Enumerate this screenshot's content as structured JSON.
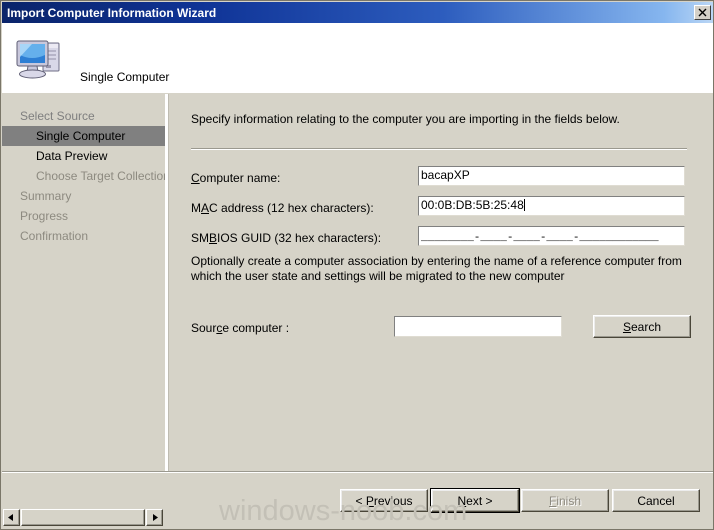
{
  "window": {
    "title": "Import Computer Information Wizard",
    "close_label": "x"
  },
  "header": {
    "title": "Single Computer",
    "icon": "computer-icon"
  },
  "sidebar": {
    "items": [
      {
        "label": "Select Source",
        "level": 0,
        "state": "done"
      },
      {
        "label": "Single Computer",
        "level": 1,
        "state": "current"
      },
      {
        "label": "Data Preview",
        "level": 1,
        "state": "next"
      },
      {
        "label": "Choose Target Collection",
        "level": 1,
        "state": "pending"
      },
      {
        "label": "Summary",
        "level": 0,
        "state": "pending"
      },
      {
        "label": "Progress",
        "level": 0,
        "state": "pending"
      },
      {
        "label": "Confirmation",
        "level": 0,
        "state": "pending"
      }
    ]
  },
  "main": {
    "intro": "Specify information relating to the computer you are importing in the fields below.",
    "fields": [
      {
        "label_prefix": "",
        "label_accel": "C",
        "label_suffix": "omputer name:",
        "value": "bacapXP",
        "focused": false
      },
      {
        "label_prefix": "M",
        "label_accel": "A",
        "label_suffix": "C address (12 hex characters):",
        "value": "00:0B:DB:5B:25:48",
        "focused": true
      },
      {
        "label_prefix": "SM",
        "label_accel": "B",
        "label_suffix": "IOS GUID (32 hex characters):",
        "value": "________-____-____-____-____________",
        "focused": false
      }
    ],
    "association_text": "Optionally create a computer association by entering the name of a reference computer from which the user state and settings will be migrated to the new computer",
    "source_label": "Source computer :",
    "source_label_prefix": "Sour",
    "source_label_accel": "c",
    "source_label_suffix": "e computer :",
    "source_value": "",
    "search_button": {
      "prefix": "",
      "accel": "S",
      "suffix": "earch"
    }
  },
  "footer": {
    "buttons": [
      {
        "name": "previous",
        "prefix": "< ",
        "accel": "P",
        "suffix": "revious",
        "disabled": false,
        "default": false
      },
      {
        "name": "next",
        "prefix": "",
        "accel": "N",
        "suffix": "ext >",
        "disabled": false,
        "default": true
      },
      {
        "name": "finish",
        "prefix": "",
        "accel": "F",
        "suffix": "inish",
        "disabled": true,
        "default": false
      },
      {
        "name": "cancel",
        "prefix": "",
        "accel": "",
        "suffix": "Cancel",
        "disabled": false,
        "default": false
      }
    ]
  },
  "watermark": {
    "text": "windows-noob.com"
  },
  "colors": {
    "dialog_face": "#d6d3c8",
    "title_dark": "#0a246a",
    "title_light": "#bcd7f5",
    "highlight": "#808080"
  }
}
